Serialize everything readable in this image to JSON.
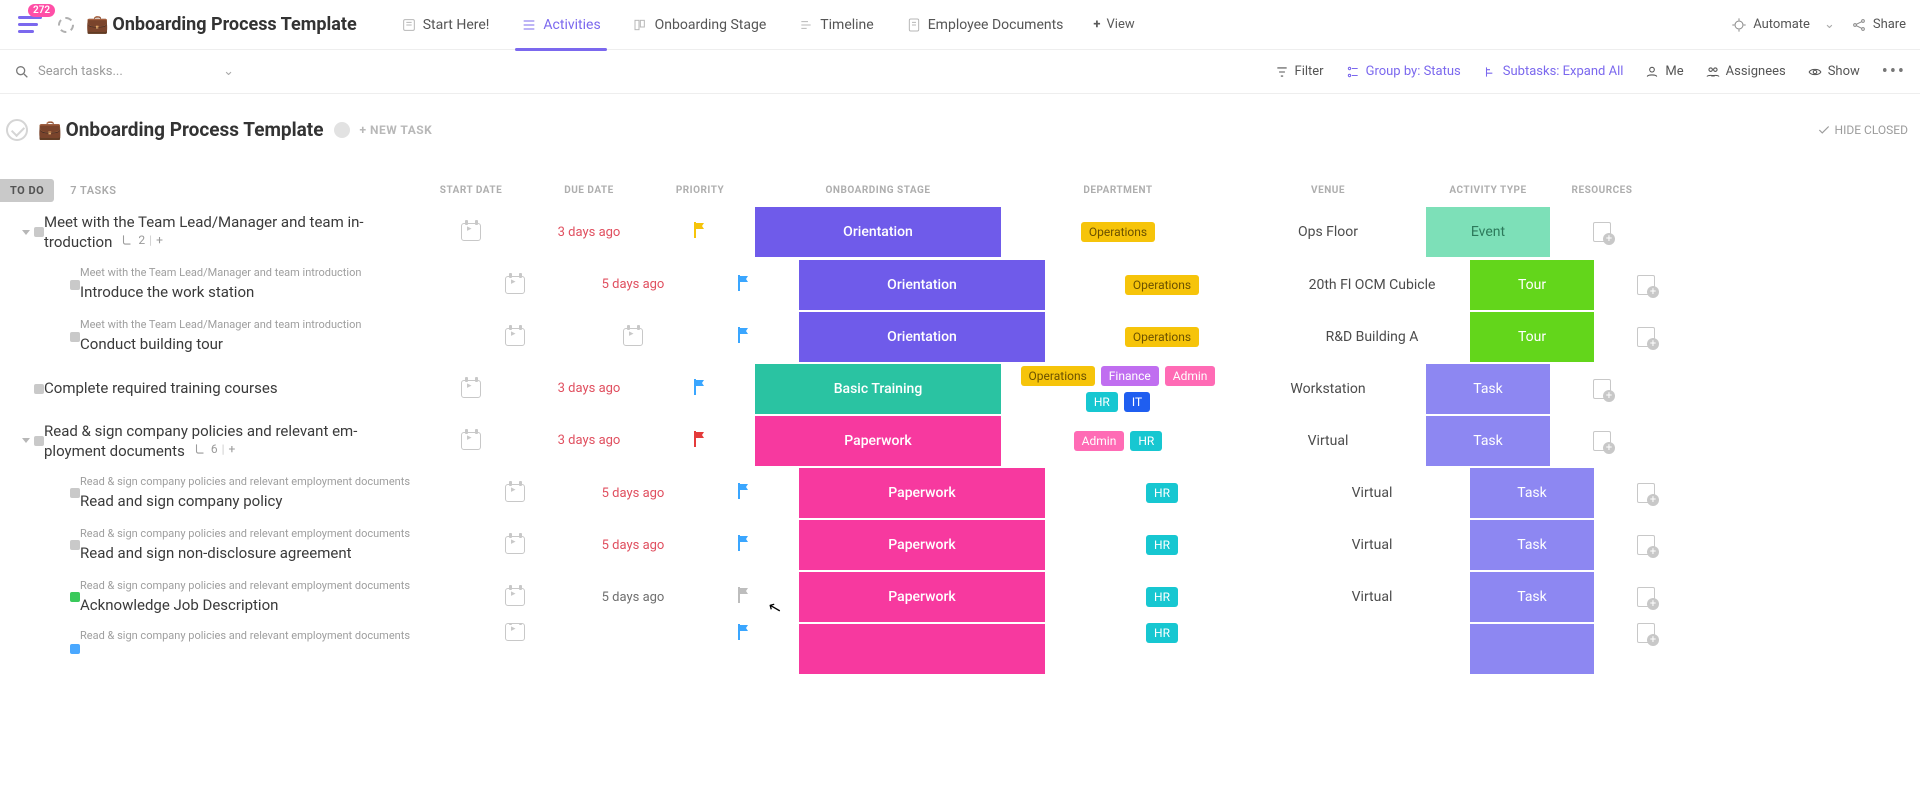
{
  "badge_count": "272",
  "space_title": "Onboarding Process Template",
  "views": {
    "v0": "Start Here!",
    "v1": "Activities",
    "v2": "Onboarding Stage",
    "v3": "Timeline",
    "v4": "Employee Documents",
    "add": "View"
  },
  "top_right": {
    "automate": "Automate",
    "share": "Share"
  },
  "search_placeholder": "Search tasks...",
  "toolbar": {
    "filter": "Filter",
    "group": "Group by: Status",
    "subtasks": "Subtasks: Expand All",
    "me": "Me",
    "assignees": "Assignees",
    "show": "Show"
  },
  "list_title": "Onboarding Process Template",
  "new_task": "+ NEW TASK",
  "hide_closed": "HIDE CLOSED",
  "group": {
    "status": "TO DO",
    "count": "7 TASKS"
  },
  "columns": {
    "start": "START DATE",
    "due": "DUE DATE",
    "priority": "PRIORITY",
    "stage": "ONBOARDING STAGE",
    "dept": "DEPARTMENT",
    "venue": "VENUE",
    "type": "ACTIVITY TYPE",
    "res": "RESOURCES"
  },
  "tasks": [
    {
      "name": "Meet with the Team Lead/Manager and team in­troduction",
      "sub_label": "2",
      "due": "3 days ago",
      "due_cls": "due-red",
      "flag": "#f6c40a",
      "stage": "Orientation",
      "stage_cls": "orientation",
      "dept": [
        "operations"
      ],
      "dept_labels": {
        "operations": "Operations"
      },
      "venue": "Ops Floor",
      "type": "Event",
      "type_cls": "type-event",
      "sub": false,
      "parent": "",
      "caret": true
    },
    {
      "name": "Introduce the work station",
      "due": "5 days ago",
      "due_cls": "due-red",
      "flag": "#3aa6ff",
      "stage": "Orientation",
      "stage_cls": "orientation",
      "dept": [
        "operations"
      ],
      "dept_labels": {
        "operations": "Operations"
      },
      "venue": "20th Fl OCM Cubicle",
      "type": "Tour",
      "type_cls": "type-tour",
      "sub": true,
      "parent": "Meet with the Team Lead/Manager and team introduction"
    },
    {
      "name": "Conduct building tour",
      "due": "",
      "due_cls": "",
      "flag": "#3aa6ff",
      "stage": "Orientation",
      "stage_cls": "orientation",
      "dept": [
        "operations"
      ],
      "dept_labels": {
        "operations": "Operations"
      },
      "venue": "R&D Building A",
      "type": "Tour",
      "type_cls": "type-tour",
      "sub": true,
      "parent": "Meet with the Team Lead/Manager and team introduction",
      "due_cal": true
    },
    {
      "name": "Complete required training courses",
      "due": "3 days ago",
      "due_cls": "due-red",
      "flag": "#3aa6ff",
      "stage": "Basic Training",
      "stage_cls": "training",
      "dept": [
        "operations",
        "finance",
        "admin",
        "hr",
        "it"
      ],
      "dept_labels": {
        "operations": "Operations",
        "finance": "Finance",
        "admin": "Admin",
        "hr": "HR",
        "it": "IT"
      },
      "venue": "Workstation",
      "type": "Task",
      "type_cls": "type-task",
      "sub": false,
      "parent": ""
    },
    {
      "name": "Read & sign company policies and relevant em­ployment documents",
      "sub_label": "6",
      "due": "3 days ago",
      "due_cls": "due-red",
      "flag": "#e43b3b",
      "stage": "Paperwork",
      "stage_cls": "paperwork",
      "dept": [
        "admin",
        "hr"
      ],
      "dept_labels": {
        "admin": "Admin",
        "hr": "HR"
      },
      "venue": "Virtual",
      "type": "Task",
      "type_cls": "type-task",
      "sub": false,
      "parent": "",
      "caret": true
    },
    {
      "name": "Read and sign company policy",
      "due": "5 days ago",
      "due_cls": "due-red",
      "flag": "#3aa6ff",
      "stage": "Paperwork",
      "stage_cls": "paperwork",
      "dept": [
        "hr"
      ],
      "dept_labels": {
        "hr": "HR"
      },
      "venue": "Virtual",
      "type": "Task",
      "type_cls": "type-task",
      "sub": true,
      "parent": "Read & sign company policies and relevant employment documents"
    },
    {
      "name": "Read and sign non-disclosure agreement",
      "due": "5 days ago",
      "due_cls": "due-red",
      "flag": "#3aa6ff",
      "stage": "Paperwork",
      "stage_cls": "paperwork",
      "dept": [
        "hr"
      ],
      "dept_labels": {
        "hr": "HR"
      },
      "venue": "Virtual",
      "type": "Task",
      "type_cls": "type-task",
      "sub": true,
      "parent": "Read & sign company policies and relevant employment documents"
    },
    {
      "name": "Acknowledge Job Description",
      "due": "5 days ago",
      "due_cls": "due-gray",
      "flag": "#bdbdbd",
      "stage": "Paperwork",
      "stage_cls": "paperwork",
      "dept": [
        "hr"
      ],
      "dept_labels": {
        "hr": "HR"
      },
      "venue": "Virtual",
      "type": "Task",
      "type_cls": "type-task",
      "sub": true,
      "parent": "Read & sign company policies and relevant employment documents",
      "sq_cls": "green"
    },
    {
      "name": "",
      "due": "",
      "due_cls": "due-red",
      "flag": "#3aa6ff",
      "stage": "",
      "stage_cls": "paperwork",
      "dept": [
        "hr"
      ],
      "dept_labels": {
        "hr": "HR"
      },
      "venue": "",
      "type": "",
      "type_cls": "type-task",
      "sub": true,
      "parent": "Read & sign company policies and relevant employment documents",
      "sq_cls": "blue",
      "partial": true
    }
  ]
}
